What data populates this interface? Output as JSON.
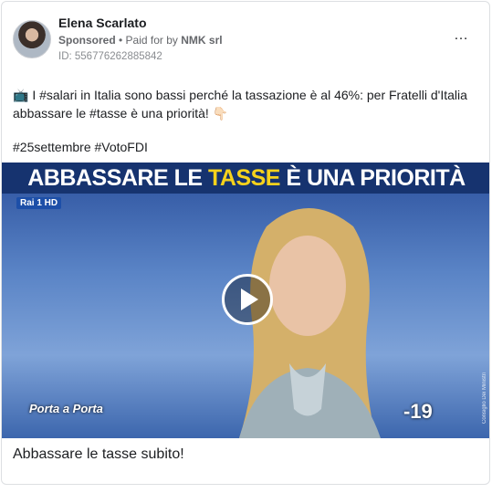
{
  "post": {
    "author": "Elena Scarlato",
    "sponsored_label": "Sponsored",
    "paid_prefix": " • Paid for by ",
    "paid_by": "NMK srl",
    "ad_id": "ID: 556776262885842",
    "more_icon": "…",
    "text_icon": "📺",
    "text": " I #salari in Italia sono bassi perché la tassazione è al 46%: per Fratelli d'Italia abbassare le #tasse è una priorità! 👇🏻",
    "hashtags": "#25settembre #VotoFDI",
    "media": {
      "banner_part1": "ABBASSARE LE ",
      "banner_highlight": "TASSE",
      "banner_part2": " È UNA PRIORITÀ",
      "channel": "Rai 1 HD",
      "show": "Porta a Porta",
      "countdown": "-19",
      "photo_credit": "Consiglio Dei Ministri"
    },
    "caption": "Abbassare le tasse subito!"
  },
  "colors": {
    "banner_bg": "#16336f",
    "banner_highlight": "#f6d21c",
    "text": "#1c1e21",
    "meta": "#65676b"
  }
}
